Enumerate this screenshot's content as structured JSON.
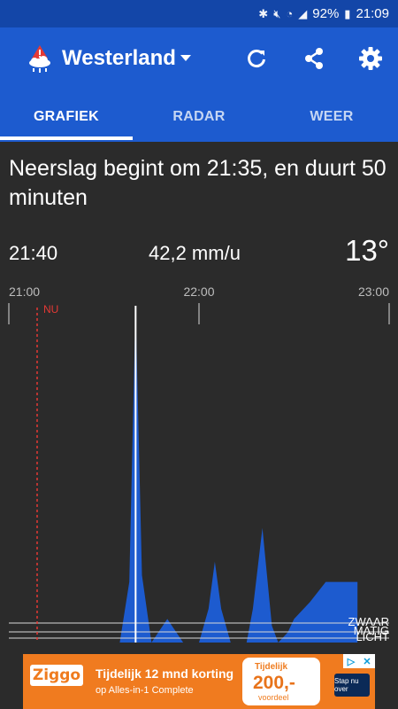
{
  "status": {
    "battery": "92%",
    "time": "21:09"
  },
  "appbar": {
    "location": "Westerland"
  },
  "tabs": [
    {
      "label": "GRAFIEK"
    },
    {
      "label": "RADAR"
    },
    {
      "label": "WEER"
    }
  ],
  "headline": "Neerslag begint om 21:35, en duurt 50 minuten",
  "info": {
    "time": "21:40",
    "rate": "42,2 mm/u",
    "temperature": "13°"
  },
  "chart_data": {
    "type": "area",
    "x_ticks": [
      "21:00",
      "22:00",
      "23:00"
    ],
    "now_label": "NU",
    "intensity_levels": [
      "ZWAAR",
      "MATIG",
      "LICHT"
    ],
    "x_minutes": [
      0,
      35,
      38,
      40,
      42,
      45,
      50,
      55,
      60,
      63,
      65,
      67,
      70,
      72,
      75,
      77,
      80,
      83,
      85,
      88,
      90,
      95,
      100,
      105,
      110
    ],
    "y_relative": [
      0,
      0,
      0.18,
      1.0,
      0.2,
      0.0,
      0.07,
      0.0,
      0.0,
      0.1,
      0.24,
      0.1,
      0.0,
      0.0,
      0.0,
      0.1,
      0.34,
      0.05,
      0.0,
      0.03,
      0.07,
      0.12,
      0.18,
      0.18,
      0.18
    ],
    "selected_x": "21:40",
    "colors": {
      "fill": "#1d5bcf",
      "now_line": "#e53935",
      "selected_line": "#ffffff"
    }
  },
  "ad": {
    "brand": "Ziggo",
    "headline": "Tijdelijk 12 mnd korting",
    "subline": "op Alles-in-1 Complete",
    "badge_top": "Tijdelijk",
    "badge_value": "200,-",
    "badge_bottom": "voordeel",
    "cta": "Stap nu over"
  }
}
